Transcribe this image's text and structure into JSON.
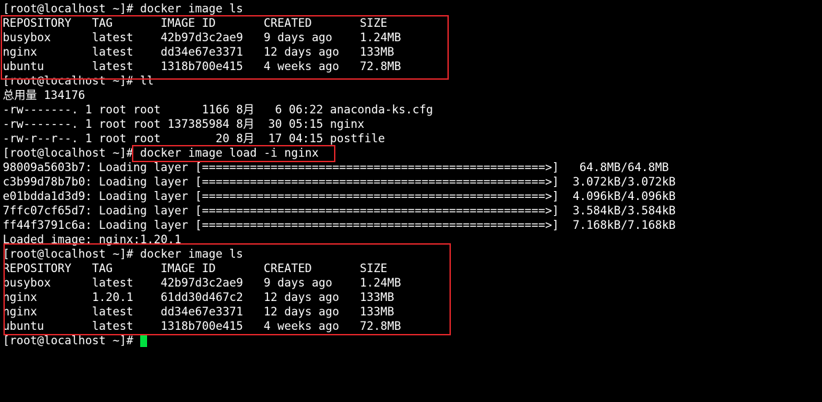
{
  "terminal": {
    "lines": [
      "[root@localhost ~]# docker image ls",
      "REPOSITORY   TAG       IMAGE ID       CREATED       SIZE",
      "busybox      latest    42b97d3c2ae9   9 days ago    1.24MB",
      "nginx        latest    dd34e67e3371   12 days ago   133MB",
      "ubuntu       latest    1318b700e415   4 weeks ago   72.8MB",
      "[root@localhost ~]# ll",
      "总用量 134176",
      "-rw-------. 1 root root      1166 8月   6 06:22 anaconda-ks.cfg",
      "-rw-------. 1 root root 137385984 8月  30 05:15 nginx",
      "-rw-r--r--. 1 root root        20 8月  17 04:15 postfile",
      "[root@localhost ~]# docker image load -i nginx",
      "98009a5603b7: Loading layer [==================================================>]   64.8MB/64.8MB",
      "c3b99d78b7b0: Loading layer [==================================================>]  3.072kB/3.072kB",
      "e01bdda1d3d9: Loading layer [==================================================>]  4.096kB/4.096kB",
      "7ffc07cf65d7: Loading layer [==================================================>]  3.584kB/3.584kB",
      "ff44f3791c6a: Loading layer [==================================================>]  7.168kB/7.168kB",
      "Loaded image: nginx:1.20.1",
      "[root@localhost ~]# docker image ls",
      "REPOSITORY   TAG       IMAGE ID       CREATED       SIZE",
      "busybox      latest    42b97d3c2ae9   9 days ago    1.24MB",
      "nginx        1.20.1    61dd30d467c2   12 days ago   133MB",
      "nginx        latest    dd34e67e3371   12 days ago   133MB",
      "ubuntu       latest    1318b700e415   4 weeks ago   72.8MB"
    ],
    "prompt": "[root@localhost ~]# ",
    "colors": {
      "background": "#000000",
      "text": "#ffffff",
      "cursor": "#00e040",
      "highlight": "#e0262a"
    }
  }
}
